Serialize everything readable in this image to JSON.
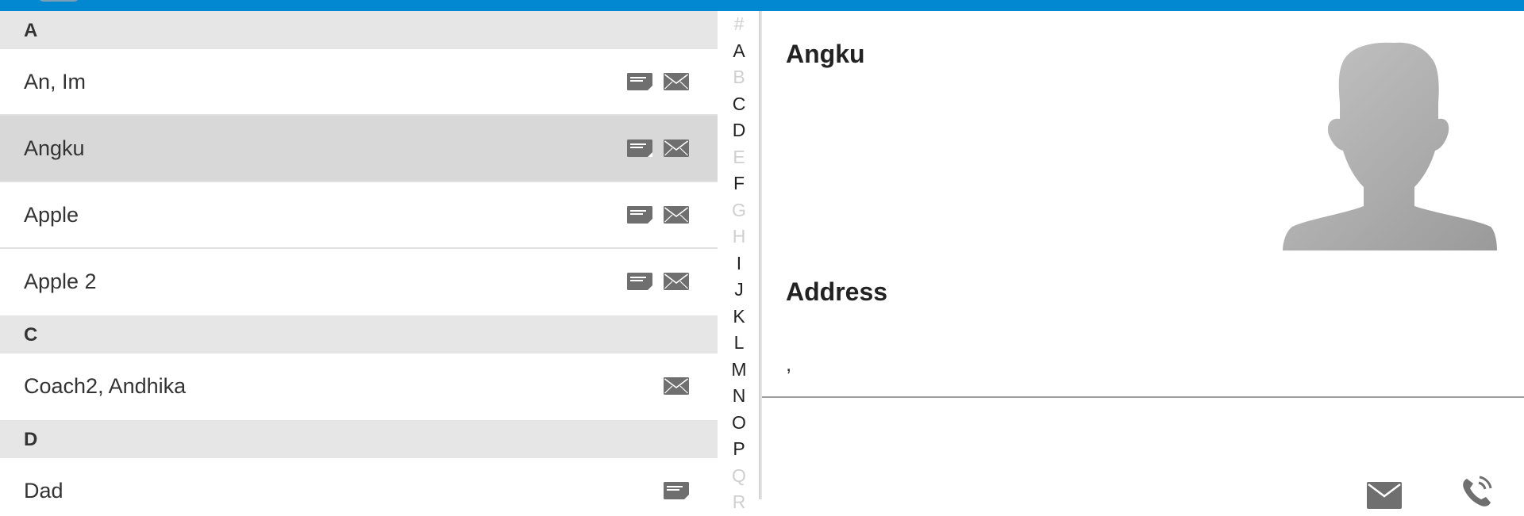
{
  "contacts": {
    "sections": [
      {
        "letter": "A",
        "items": [
          {
            "name": "An, Im",
            "icons": [
              "message-icon",
              "email-icon"
            ]
          },
          {
            "name": "Angku",
            "icons": [
              "message-icon",
              "email-icon"
            ],
            "selected": true
          },
          {
            "name": "Apple",
            "icons": [
              "message-icon",
              "email-icon"
            ]
          },
          {
            "name": "Apple 2",
            "icons": [
              "message-icon",
              "email-icon"
            ]
          }
        ]
      },
      {
        "letter": "C",
        "items": [
          {
            "name": "Coach2, Andhika",
            "icons": [
              "email-icon"
            ]
          }
        ]
      },
      {
        "letter": "D",
        "items": [
          {
            "name": "Dad",
            "icons": [
              "message-icon"
            ]
          }
        ]
      }
    ]
  },
  "alphabet_index": [
    {
      "letter": "#",
      "enabled": false
    },
    {
      "letter": "A",
      "enabled": true
    },
    {
      "letter": "B",
      "enabled": false
    },
    {
      "letter": "C",
      "enabled": true
    },
    {
      "letter": "D",
      "enabled": true
    },
    {
      "letter": "E",
      "enabled": false
    },
    {
      "letter": "F",
      "enabled": true
    },
    {
      "letter": "G",
      "enabled": false
    },
    {
      "letter": "H",
      "enabled": false
    },
    {
      "letter": "I",
      "enabled": true
    },
    {
      "letter": "J",
      "enabled": true
    },
    {
      "letter": "K",
      "enabled": true
    },
    {
      "letter": "L",
      "enabled": true
    },
    {
      "letter": "M",
      "enabled": true
    },
    {
      "letter": "N",
      "enabled": true
    },
    {
      "letter": "O",
      "enabled": true
    },
    {
      "letter": "P",
      "enabled": true
    },
    {
      "letter": "Q",
      "enabled": false
    },
    {
      "letter": "R",
      "enabled": false
    }
  ],
  "detail": {
    "name": "Angku",
    "address_label": "Address",
    "address_value": ",",
    "avatar_icon": "person-silhouette-icon",
    "actions": [
      {
        "icon": "email-icon"
      },
      {
        "icon": "phone-icon"
      }
    ]
  },
  "colors": {
    "topbar": "#0288d1",
    "section_header_bg": "#e6e6e6",
    "selected_row_bg": "#d8d8d8",
    "icon_gray": "#6f6f6f",
    "alpha_disabled": "#cfcfcf"
  }
}
